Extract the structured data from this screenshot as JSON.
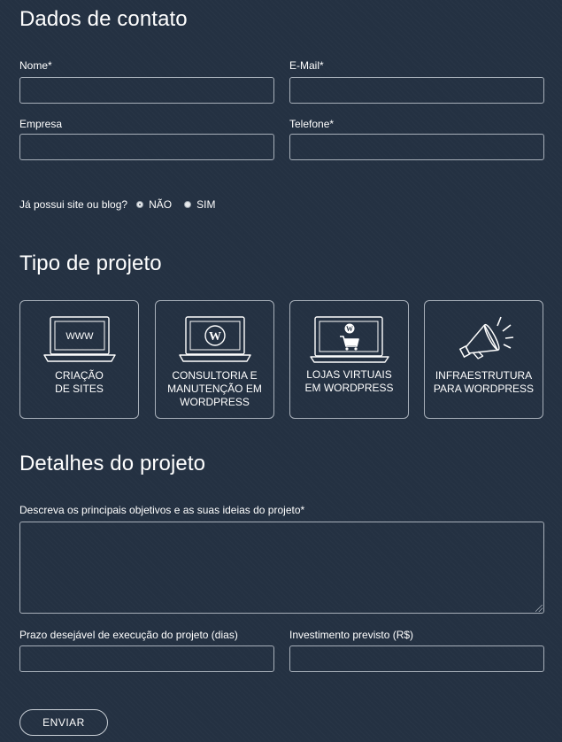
{
  "contact": {
    "title": "Dados de contato",
    "name_label": "Nome*",
    "name_value": "",
    "email_label": "E-Mail*",
    "email_value": "",
    "company_label": "Empresa",
    "company_value": "",
    "phone_label": "Telefone*",
    "phone_value": "",
    "site_question": "Já possui site ou blog?",
    "site_options": [
      {
        "label": "NÃO",
        "checked": true
      },
      {
        "label": "SIM",
        "checked": false
      }
    ]
  },
  "project_type": {
    "title": "Tipo de projeto",
    "cards": [
      {
        "icon": "laptop-www-icon",
        "icon_text": "WWW",
        "line1": "CRIAÇÃO",
        "line2": "DE SITES",
        "line3": ""
      },
      {
        "icon": "laptop-wordpress-icon",
        "line1": "CONSULTORIA E",
        "line2": "MANUTENÇÃO EM",
        "line3": "WORDPRESS"
      },
      {
        "icon": "laptop-wordpress-cart-icon",
        "line1": "LOJAS VIRTUAIS",
        "line2": "EM WORDPRESS",
        "line3": ""
      },
      {
        "icon": "megaphone-icon",
        "line1": "INFRAESTRUTURA",
        "line2": "PARA WORDPRESS",
        "line3": ""
      }
    ]
  },
  "details": {
    "title": "Detalhes do projeto",
    "description_label": "Descreva os principais objetivos e as suas ideias do projeto*",
    "description_value": "",
    "deadline_label": "Prazo desejável de execução do projeto (dias)",
    "deadline_value": "",
    "budget_label": "Investimento previsto (R$)",
    "budget_value": ""
  },
  "submit_label": "ENVIAR"
}
